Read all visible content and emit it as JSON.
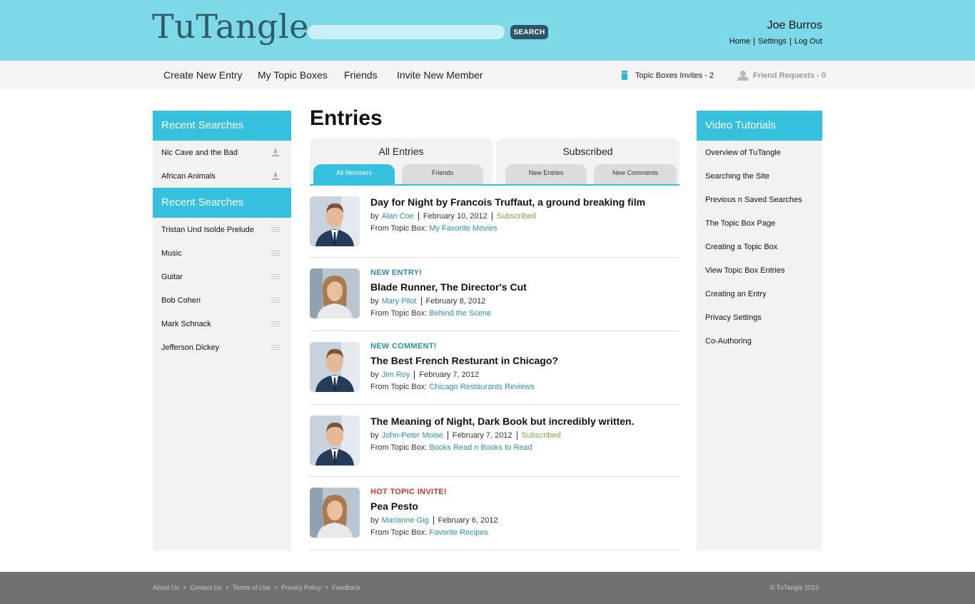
{
  "header": {
    "logo": "TuTangle",
    "search_placeholder": "",
    "search_button": "SEARCH",
    "user_name": "Joe Burros",
    "links": [
      "Home",
      "Settings",
      "Log Out"
    ]
  },
  "nav": {
    "items": [
      "Create New Entry",
      "My Topic Boxes",
      "Friends",
      "Invite New Member"
    ],
    "topic_invites": "Topic Boxes Invites - 2",
    "friend_requests": "Friend Requests - 0"
  },
  "left_sidebar": {
    "section1": {
      "title": "Recent Searches",
      "items": [
        "Nic Cave and the Bad",
        "African Animals"
      ]
    },
    "section2": {
      "title": "Recent Searches",
      "items": [
        "Tristan Und Isolde Prelude",
        "Music",
        "Guitar",
        "Bob Cohen",
        "Mark Schnack",
        "Jefferson Dickey"
      ]
    }
  },
  "main": {
    "title": "Entries",
    "tab_groups": [
      {
        "title": "All Entries",
        "tabs": [
          "All Members",
          "Friends"
        ]
      },
      {
        "title": "Subscribed",
        "tabs": [
          "New Entries",
          "New Comments"
        ]
      }
    ],
    "entries": [
      {
        "tag": "",
        "title": "Day for Night by Francois Truffaut, a ground breaking film",
        "by": "by",
        "author": "Alan Coe",
        "date": "February 10, 2012",
        "subscribed": "Subscribed",
        "from_label": "From Topic Box:",
        "topic_box": "My Favorite Movies",
        "avatar": "man"
      },
      {
        "tag": "NEW ENTRY!",
        "title": "Blade Runner, The Director's Cut",
        "by": "by",
        "author": "Mary Pilot",
        "date": "February 8, 2012",
        "subscribed": "",
        "from_label": "From Topic Box:",
        "topic_box": "Behind the Scene",
        "avatar": "woman"
      },
      {
        "tag": "NEW COMMENT!",
        "title": "The Best French Resturant in Chicago?",
        "by": "by",
        "author": "Jim Roy",
        "date": "February 7, 2012",
        "subscribed": "",
        "from_label": "From Topic Box:",
        "topic_box": "Chicago Restaurants Reviews",
        "avatar": "man"
      },
      {
        "tag": "",
        "title": "The Meaning of Night, Dark Book but incredibly written.",
        "by": "by",
        "author": "John-Peter Moise",
        "date": "February 7, 2012",
        "subscribed": "Subscribed",
        "from_label": "From Topic Box:",
        "topic_box": "Books Read n Books to Read",
        "avatar": "man"
      },
      {
        "tag": "HOT TOPIC INVITE!",
        "title": "Pea Pesto",
        "by": "by",
        "author": "Marianne Gig",
        "date": "February 6, 2012",
        "subscribed": "",
        "from_label": "From Topic Box:",
        "topic_box": "Favorite Recipes",
        "avatar": "woman"
      }
    ]
  },
  "right_sidebar": {
    "title": "Video Tutorials",
    "items": [
      "Overview of TuTangle",
      "Searching the Site",
      "Previous n Saved Searches",
      "The Topic Box Page",
      "Creating a Topic Box",
      "View Topic Box Entries",
      "Creating an Entry",
      "Privacy Settings",
      "Co-Authoring"
    ]
  },
  "footer": {
    "links": [
      "About Us",
      "Contact Us",
      "Terms of Use",
      "Privacy Policy",
      "Feedback"
    ],
    "copyright": "© TuTangle 2013"
  },
  "colors": {
    "header_bg": "#7dd9e8",
    "accent": "#35c0de",
    "link": "#2f8e9d",
    "subscribed": "#7aa445",
    "hot": "#c0392b",
    "footer_bg": "#717171"
  }
}
